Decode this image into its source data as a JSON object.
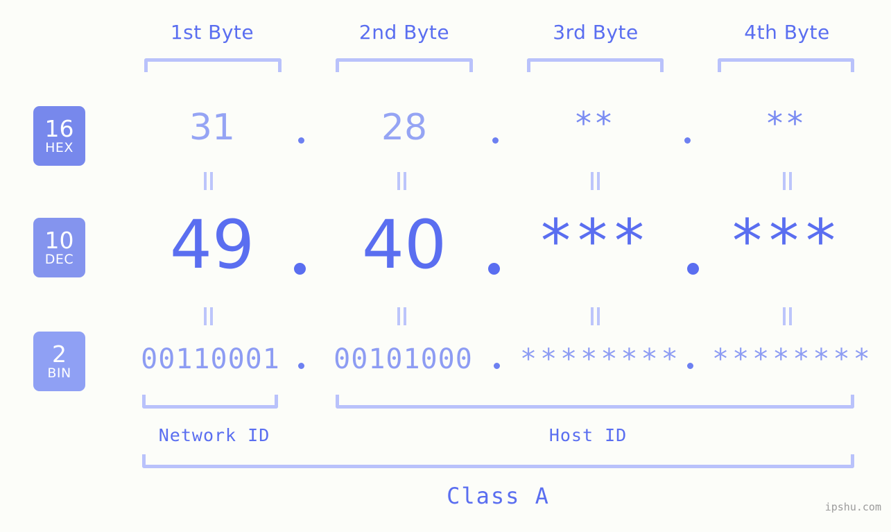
{
  "background_color": "#fcfdf9",
  "accent_color": "#5a6ef0",
  "bracket_color": "#b9c2fb",
  "byte_headers": [
    {
      "label": "1st Byte"
    },
    {
      "label": "2nd Byte"
    },
    {
      "label": "3rd Byte"
    },
    {
      "label": "4th Byte"
    }
  ],
  "radix_badges": [
    {
      "number": "16",
      "label": "HEX",
      "color": "#7788ec"
    },
    {
      "number": "10",
      "label": "DEC",
      "color": "#8494ee"
    },
    {
      "number": "2",
      "label": "BIN",
      "color": "#8fa0f4"
    }
  ],
  "rows": {
    "hex": {
      "radix": "16",
      "name": "HEX",
      "values": [
        "31",
        "28",
        "**",
        "**"
      ],
      "separators": [
        ".",
        ".",
        "."
      ]
    },
    "dec": {
      "radix": "10",
      "name": "DEC",
      "values": [
        "49",
        "40",
        "***",
        "***"
      ],
      "separators": [
        ".",
        ".",
        "."
      ]
    },
    "bin": {
      "radix": "2",
      "name": "BIN",
      "values": [
        "00110001",
        "00101000",
        "********",
        "********"
      ],
      "separators": [
        ".",
        ".",
        "."
      ]
    }
  },
  "equals_marks": [
    "||",
    "||",
    "||",
    "||",
    "||",
    "||",
    "||",
    "||"
  ],
  "segments": {
    "network_id": "Network ID",
    "host_id": "Host ID",
    "ip_class": "Class A"
  },
  "watermark": "ipshu.com"
}
